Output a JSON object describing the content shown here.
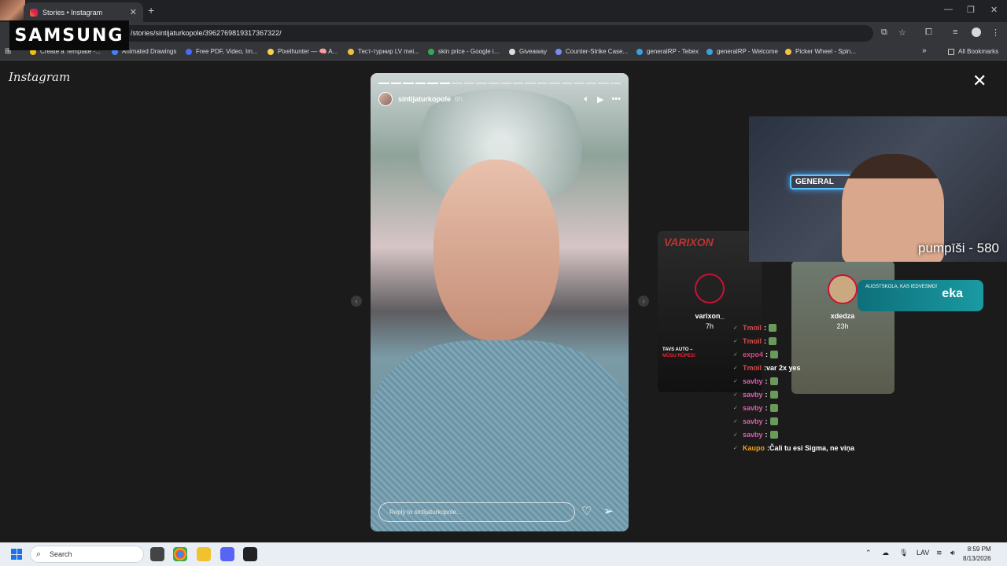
{
  "browser": {
    "tab_title": "Stories • Instagram",
    "url": "/stories/sintijaturkopole/3962769819317367322/",
    "bookmarks": [
      {
        "label": "Create a Template -...",
        "color": "#f4c20d"
      },
      {
        "label": "Animated Drawings",
        "color": "#4285f4"
      },
      {
        "label": "Free PDF, Video, Im...",
        "color": "#4a6cf7"
      },
      {
        "label": "Pixelhunter — 🧠 A...",
        "color": "#f6d34a"
      },
      {
        "label": "Тест-турнир LV mei...",
        "color": "#f0c040"
      },
      {
        "label": "skin price - Google i...",
        "color": "#34a853"
      },
      {
        "label": "Giveaway",
        "color": "#dddddd"
      },
      {
        "label": "Counter-Strike Case...",
        "color": "#7a8cf0"
      },
      {
        "label": "generalRP - Tebex",
        "color": "#3ca0e0"
      },
      {
        "label": "generalRP - Welcome",
        "color": "#3ca0e0"
      },
      {
        "label": "Picker Wheel - Spin...",
        "color": "#f5c242"
      }
    ],
    "all_bookmarks": "All Bookmarks"
  },
  "overlay": {
    "samsung": "SAMSUNG",
    "webcam_neon": "GENERAL",
    "counter": "pumpīši - 580"
  },
  "page": {
    "logo": "Instagram",
    "close": "✕"
  },
  "story": {
    "username": "sintijaturkopole",
    "age": "6h",
    "reply_placeholder": "Reply to sintijaturkopole...",
    "segments_total": 20,
    "segments_done": 6
  },
  "previews": [
    {
      "name": "varixon_",
      "age": "7h",
      "brand": "VARIXON",
      "promo_1": "TAVS AUTO –",
      "promo_2": "MŪSU RŪPES!"
    },
    {
      "name": "xdedza",
      "age": "23h",
      "academy_small": "AUGSTSKOLA, KAS IEDVESMO!",
      "academy_big": "eka"
    }
  ],
  "chat": [
    {
      "user": "Tmoil",
      "color": "#d94b4b",
      "msg": "",
      "emote": true
    },
    {
      "user": "Tmoil",
      "color": "#d94b4b",
      "msg": "",
      "emote": true
    },
    {
      "user": "expo4",
      "color": "#e04580",
      "msg": "",
      "emote": true
    },
    {
      "user": "Tmoil",
      "color": "#d94b4b",
      "msg": "var 2x yes",
      "emote": false
    },
    {
      "user": "savby",
      "color": "#e05fb0",
      "msg": "",
      "emote": true
    },
    {
      "user": "savby",
      "color": "#e05fb0",
      "msg": "",
      "emote": true
    },
    {
      "user": "savby",
      "color": "#e05fb0",
      "msg": "",
      "emote": true
    },
    {
      "user": "savby",
      "color": "#e05fb0",
      "msg": "",
      "emote": true
    },
    {
      "user": "savby",
      "color": "#e05fb0",
      "msg": "",
      "emote": true
    },
    {
      "user": "Kaupo",
      "color": "#f0a020",
      "msg": "Čali tu esi Sigma, ne viņa",
      "emote": false
    }
  ],
  "taskbar": {
    "search": "Search",
    "lang": "LAV",
    "time": "8:59 PM",
    "date": "8/13/2026"
  }
}
